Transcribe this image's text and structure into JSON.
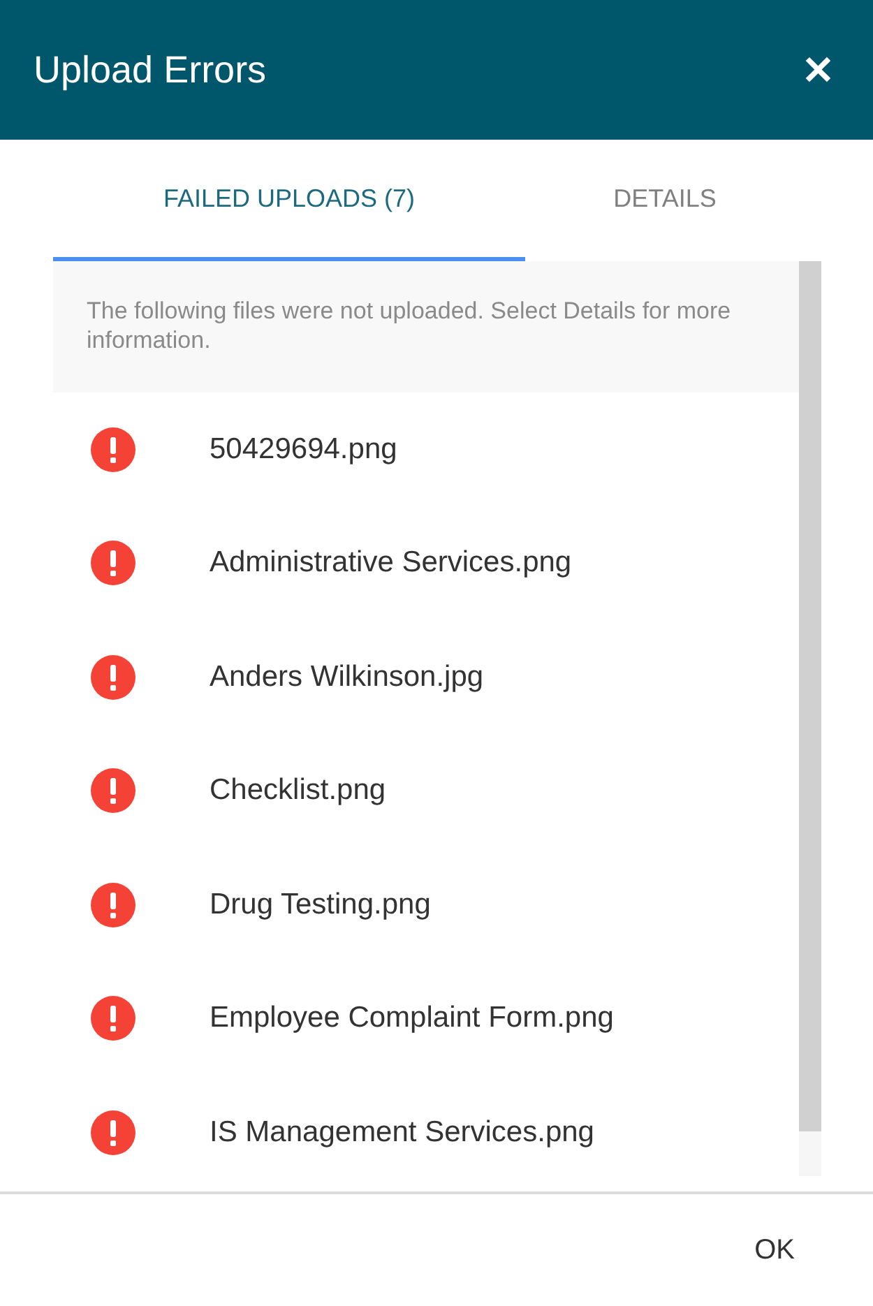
{
  "dialog": {
    "title": "Upload Errors",
    "close": "✕"
  },
  "tabs": [
    {
      "label": "FAILED UPLOADS (7)",
      "selected": true
    },
    {
      "label": "DETAILS",
      "selected": false
    }
  ],
  "notice": "The following files were not uploaded. Select Details for more information.",
  "files": [
    {
      "name": "50429694.png"
    },
    {
      "name": "Administrative Services.png"
    },
    {
      "name": "Anders Wilkinson.jpg"
    },
    {
      "name": "Checklist.png"
    },
    {
      "name": "Drug Testing.png"
    },
    {
      "name": "Employee Complaint Form.png"
    },
    {
      "name": "IS Management Services.png"
    }
  ],
  "buttons": [
    "OK"
  ]
}
